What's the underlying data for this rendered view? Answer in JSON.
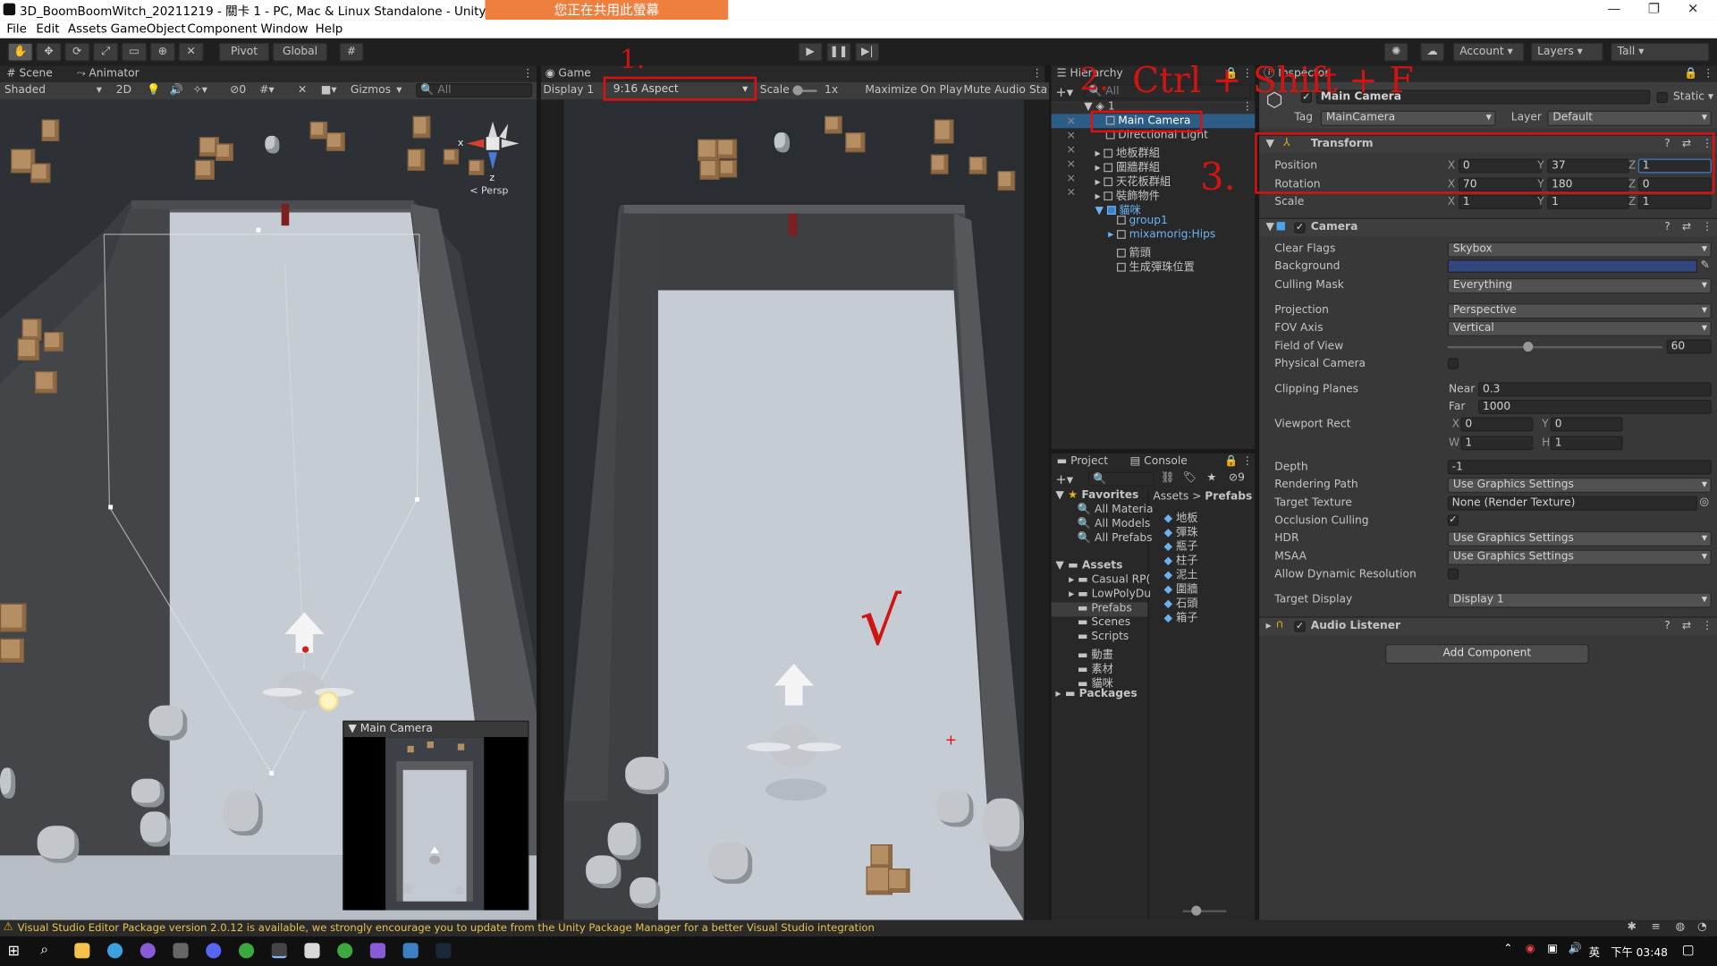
{
  "window": {
    "title": "3D_BoomBoomWitch_20211219 - 關卡 1 - PC, Mac & Linux Standalone - Unity 2020.3.18f1 Pe",
    "share_banner": "您正在共用此螢幕",
    "controls": [
      "—",
      "❐",
      "✕"
    ]
  },
  "menu": [
    "File",
    "Edit",
    "Assets",
    "GameObject",
    "Component",
    "Window",
    "Help"
  ],
  "toolbar": {
    "pivot": "Pivot",
    "global": "Global",
    "account": "Account",
    "layers": "Layers",
    "layout": "Tall"
  },
  "scene": {
    "tabs": [
      "Scene",
      "Animator"
    ],
    "shading": "Shaded",
    "mode_2d": "2D",
    "fx_count": "0",
    "gizmos": "Gizmos",
    "search_placeholder": "All",
    "persp_label": "< Persp",
    "gizmo_x": "x",
    "gizmo_z": "z",
    "preview_title": "Main Camera"
  },
  "game": {
    "tab": "Game",
    "display": "Display 1",
    "aspect": "9:16 Aspect",
    "scale_label": "Scale",
    "scale_value": "1x",
    "maximize": "Maximize On Play",
    "mute": "Mute Audio",
    "stats": "Sta"
  },
  "hierarchy": {
    "tab": "Hierarchy",
    "search_placeholder": "All",
    "scene_name": "1",
    "items": [
      {
        "label": "Main Camera",
        "selected": true
      },
      {
        "label": "Directional Light"
      },
      {
        "label": "地板群組"
      },
      {
        "label": "圍牆群組"
      },
      {
        "label": "天花板群組"
      },
      {
        "label": "裝飾物件"
      },
      {
        "label": "貓咪"
      },
      {
        "label": "group1"
      },
      {
        "label": "mixamorig:Hips"
      },
      {
        "label": "箭頭"
      },
      {
        "label": "生成彈珠位置"
      }
    ]
  },
  "annotations": {
    "n1": "1.",
    "n2": "2.",
    "n3": "3.",
    "shortcut": "Ctrl + Shift + F",
    "check": "√"
  },
  "project": {
    "tabs": [
      "Project",
      "Console"
    ],
    "hidden_count": "9",
    "favorites_label": "Favorites",
    "favorites": [
      "All Materia",
      "All Models",
      "All Prefabs"
    ],
    "assets_label": "Assets",
    "folders": [
      "Casual RP(",
      "LowPolyDu",
      "Prefabs",
      "Scenes",
      "Scripts",
      "動畫",
      "素材",
      "貓咪"
    ],
    "packages_label": "Packages",
    "breadcrumb": [
      "Assets",
      "Prefabs"
    ],
    "prefabs": [
      "地板",
      "彈珠",
      "瓶子",
      "柱子",
      "泥土",
      "圍牆",
      "石頭",
      "箱子"
    ]
  },
  "inspector": {
    "tab": "Inspector",
    "object_name": "Main Camera",
    "static_label": "Static",
    "tag_label": "Tag",
    "tag_value": "MainCamera",
    "layer_label": "Layer",
    "layer_value": "Default",
    "transform": {
      "title": "Transform",
      "position_label": "Position",
      "rotation_label": "Rotation",
      "scale_label": "Scale",
      "position": {
        "x": "0",
        "y": "37",
        "z": "1"
      },
      "rotation": {
        "x": "70",
        "y": "180",
        "z": "0"
      },
      "scale": {
        "x": "1",
        "y": "1",
        "z": "1"
      }
    },
    "camera": {
      "title": "Camera",
      "clear_flags_label": "Clear Flags",
      "clear_flags": "Skybox",
      "background_label": "Background",
      "background_color": "#31477e",
      "culling_mask_label": "Culling Mask",
      "culling_mask": "Everything",
      "projection_label": "Projection",
      "projection": "Perspective",
      "fov_axis_label": "FOV Axis",
      "fov_axis": "Vertical",
      "fov_label": "Field of View",
      "fov": "60",
      "fov_fraction": 0.37,
      "physical_label": "Physical Camera",
      "clipping_label": "Clipping Planes",
      "near_label": "Near",
      "near": "0.3",
      "far_label": "Far",
      "far": "1000",
      "viewport_label": "Viewport Rect",
      "vx": "0",
      "vy": "0",
      "vw": "1",
      "vh": "1",
      "depth_label": "Depth",
      "depth": "-1",
      "rendering_path_label": "Rendering Path",
      "rendering_path": "Use Graphics Settings",
      "target_texture_label": "Target Texture",
      "target_texture": "None (Render Texture)",
      "occlusion_label": "Occlusion Culling",
      "hdr_label": "HDR",
      "hdr": "Use Graphics Settings",
      "msaa_label": "MSAA",
      "msaa": "Use Graphics Settings",
      "dynres_label": "Allow Dynamic Resolution",
      "target_display_label": "Target Display",
      "target_display": "Display 1"
    },
    "audio_listener": "Audio Listener",
    "add_component": "Add Component"
  },
  "status": {
    "warning": "Visual Studio Editor Package version 2.0.12 is available, we strongly encourage you to update from the Unity Package Manager for a better Visual Studio integration"
  },
  "taskbar": {
    "time": "下午 03:48",
    "ime": "英"
  }
}
